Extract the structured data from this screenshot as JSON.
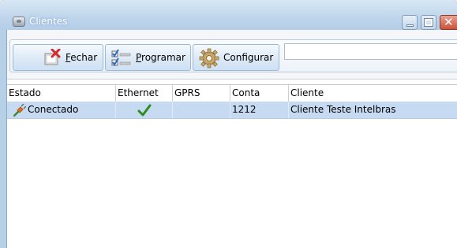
{
  "window": {
    "title": "Clientes",
    "controls": [
      "minimize",
      "maximize",
      "close"
    ],
    "close_glyph": "✕"
  },
  "toolbar": {
    "buttons": [
      {
        "label": "Fechar",
        "icon": "close-document-icon",
        "accel": "F"
      },
      {
        "label": "Programar",
        "icon": "checklist-icon",
        "accel": "P"
      },
      {
        "label": "Configurar",
        "icon": "gear-icon"
      }
    ],
    "search_value": ""
  },
  "table": {
    "columns": [
      "Estado",
      "Ethernet",
      "GPRS",
      "Conta",
      "Cliente"
    ],
    "rows": [
      {
        "estado": "Conectado",
        "estado_icon": "plug-icon",
        "ethernet": "check-icon",
        "gprs": "",
        "conta": "1212",
        "cliente": "Cliente Teste Intelbras",
        "selected": true
      }
    ]
  },
  "colors": {
    "title_bar": "#bfd5ec",
    "selected_row": "#c6daf1",
    "check_green": "#2e8b1e",
    "close_button": "#c9523a"
  }
}
